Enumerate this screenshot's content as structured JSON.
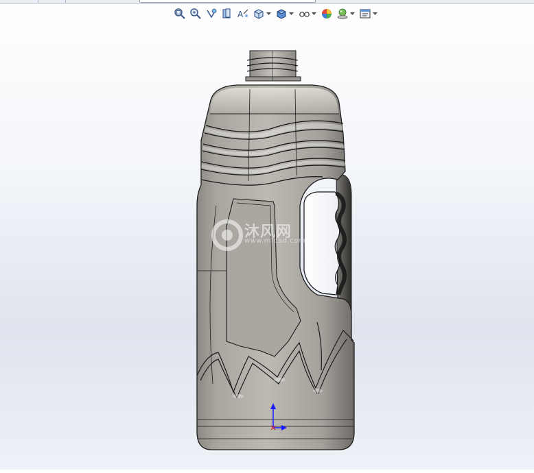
{
  "toolbar": {
    "tools": [
      {
        "id": "zoom-to-fit",
        "icon": "zoom-to-fit-icon",
        "has_menu": false
      },
      {
        "id": "zoom-to-area",
        "icon": "zoom-to-area-icon",
        "has_menu": false
      },
      {
        "id": "previous-view",
        "icon": "previous-view-icon",
        "has_menu": false
      },
      {
        "id": "section-view",
        "icon": "section-view-icon",
        "has_menu": false
      },
      {
        "id": "dynamic-annotation",
        "icon": "dynamic-annotation-icon",
        "has_menu": false
      },
      {
        "id": "view-orientation",
        "icon": "view-orientation-icon",
        "has_menu": true
      },
      {
        "id": "display-style",
        "icon": "display-style-icon",
        "has_menu": true
      },
      {
        "id": "hide-show-items",
        "icon": "hide-show-icon",
        "has_menu": true
      },
      {
        "id": "edit-appearance",
        "icon": "edit-appearance-icon",
        "has_menu": false
      },
      {
        "id": "apply-scene",
        "icon": "apply-scene-icon",
        "has_menu": true
      },
      {
        "id": "view-settings",
        "icon": "view-settings-icon",
        "has_menu": true
      }
    ]
  },
  "model": {
    "object": "bottle",
    "body_color": "#a9a6a0",
    "edge_color": "#1c1c1c",
    "origin_triad": {
      "y_axis_color": "#1a1aff",
      "x_axis_color": "#1a1aff"
    }
  },
  "watermark": {
    "cn_text": "沐风网",
    "en_text": "www.mfcad.com"
  }
}
